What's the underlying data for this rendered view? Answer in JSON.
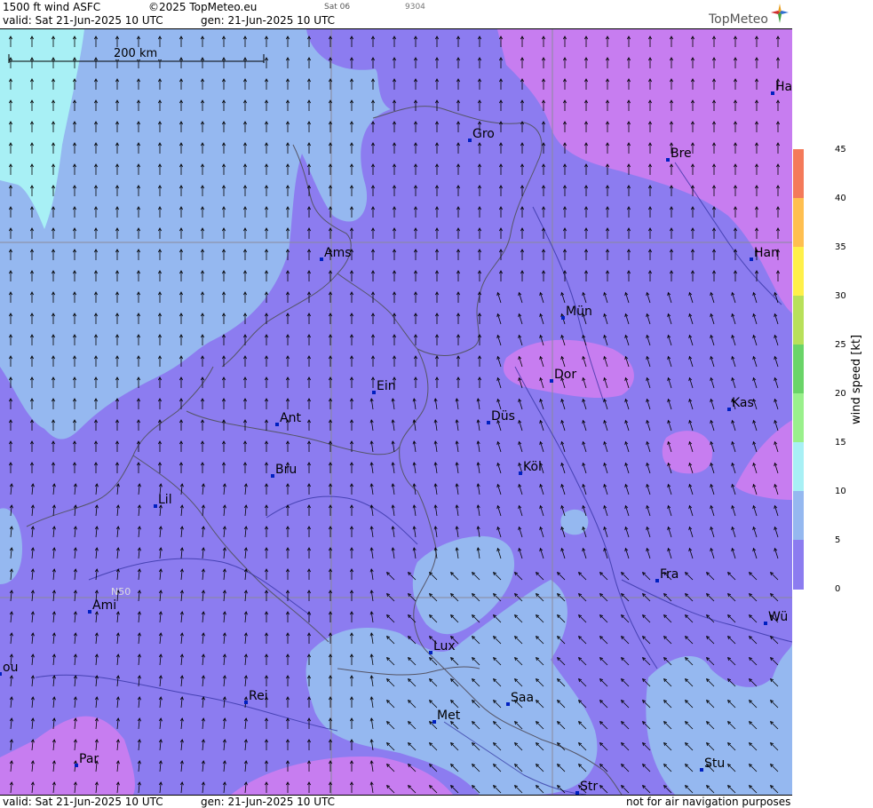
{
  "header": {
    "title": "1500 ft wind ASFC",
    "copyright": "©2025 TopMeteo.eu",
    "day_code": "Sat 06",
    "code": "9304",
    "valid": "valid:  Sat  21-Jun-2025  10 UTC",
    "gen": "gen: 21-Jun-2025 10 UTC",
    "logo": "TopMeteo"
  },
  "footer": {
    "valid": "valid:  Sat  21-Jun-2025  10 UTC",
    "gen": "gen: 21-Jun-2025 10 UTC",
    "disclaimer": "not for air navigation purposes"
  },
  "scale_bar": {
    "label": "200 km"
  },
  "lat_label": "N50",
  "legend": {
    "title": "wind  speed  [kt]",
    "ticks": [
      "45",
      "40",
      "35",
      "30",
      "25",
      "20",
      "15",
      "10",
      "5",
      "0"
    ],
    "colors": {
      "0": "#c77df0",
      "5": "#8c7cf0",
      "10": "#95b8f0",
      "15": "#a8f0f5",
      "20": "#9af08c",
      "25": "#6ad468",
      "30": "#b8e05a",
      "35": "#fff04a",
      "40": "#ffbf50",
      "45": "#f47a5a"
    }
  },
  "cities": [
    {
      "name": "Gro"
    },
    {
      "name": "Ha"
    },
    {
      "name": "Bre"
    },
    {
      "name": "Ams"
    },
    {
      "name": "Han"
    },
    {
      "name": "Mün"
    },
    {
      "name": "Dor"
    },
    {
      "name": "Ein"
    },
    {
      "name": "Kas"
    },
    {
      "name": "Ant"
    },
    {
      "name": "Düs"
    },
    {
      "name": "Bru"
    },
    {
      "name": "Köl"
    },
    {
      "name": "Lil"
    },
    {
      "name": "Fra"
    },
    {
      "name": "Ami"
    },
    {
      "name": "Wü"
    },
    {
      "name": "Lux"
    },
    {
      "name": "ou"
    },
    {
      "name": "Rei"
    },
    {
      "name": "Saa"
    },
    {
      "name": "Met"
    },
    {
      "name": "Par"
    },
    {
      "name": "Stu"
    },
    {
      "name": "Str"
    }
  ]
}
